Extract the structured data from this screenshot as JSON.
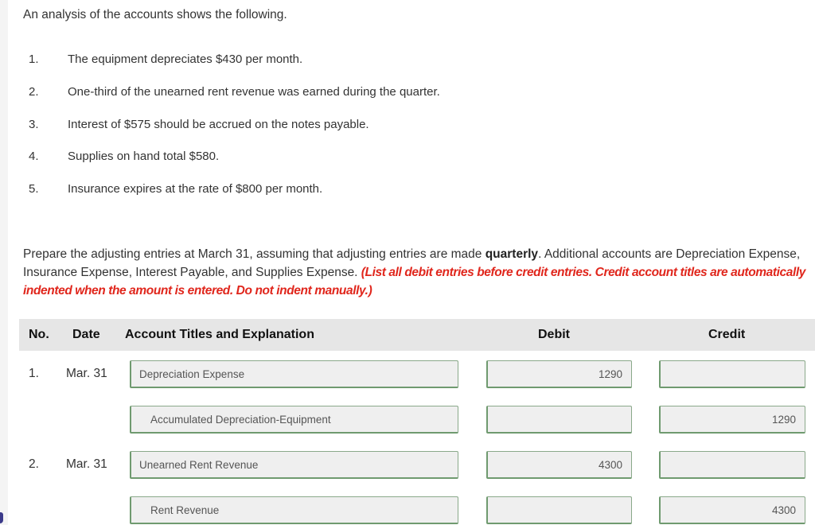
{
  "intro": "An analysis of the accounts shows the following.",
  "facts": [
    {
      "num": "1.",
      "text": "The equipment depreciates $430 per month."
    },
    {
      "num": "2.",
      "text": "One-third of the unearned rent revenue was earned during the quarter."
    },
    {
      "num": "3.",
      "text": "Interest of $575 should be accrued on the notes payable."
    },
    {
      "num": "4.",
      "text": "Supplies on hand total $580."
    },
    {
      "num": "5.",
      "text": "Insurance expires at the rate of $800 per month."
    }
  ],
  "instructions": {
    "part1": "Prepare the adjusting entries at March 31, assuming that adjusting entries are made ",
    "bold": "quarterly",
    "part2": ". Additional accounts are Depreciation Expense, Insurance Expense, Interest Payable, and Supplies Expense. ",
    "note": "(List all debit entries before credit entries. Credit account titles are automatically indented when the amount is entered. Do not indent manually.)"
  },
  "table": {
    "headers": {
      "no": "No.",
      "date": "Date",
      "account": "Account Titles and Explanation",
      "debit": "Debit",
      "credit": "Credit"
    },
    "entries": [
      {
        "no": "1.",
        "date": "Mar. 31",
        "lines": [
          {
            "account": "Depreciation Expense",
            "debit": "1290",
            "credit": ""
          },
          {
            "account": "Accumulated Depreciation-Equipment",
            "debit": "",
            "credit": "1290"
          }
        ]
      },
      {
        "no": "2.",
        "date": "Mar. 31",
        "lines": [
          {
            "account": "Unearned Rent Revenue",
            "debit": "4300",
            "credit": ""
          },
          {
            "account": "Rent Revenue",
            "debit": "",
            "credit": "4300"
          }
        ]
      }
    ]
  },
  "colors": {
    "note_red": "#e0261c",
    "field_border_green": "#6f9a6f",
    "header_bg": "#e6e6e6",
    "field_bg": "#efefef"
  }
}
